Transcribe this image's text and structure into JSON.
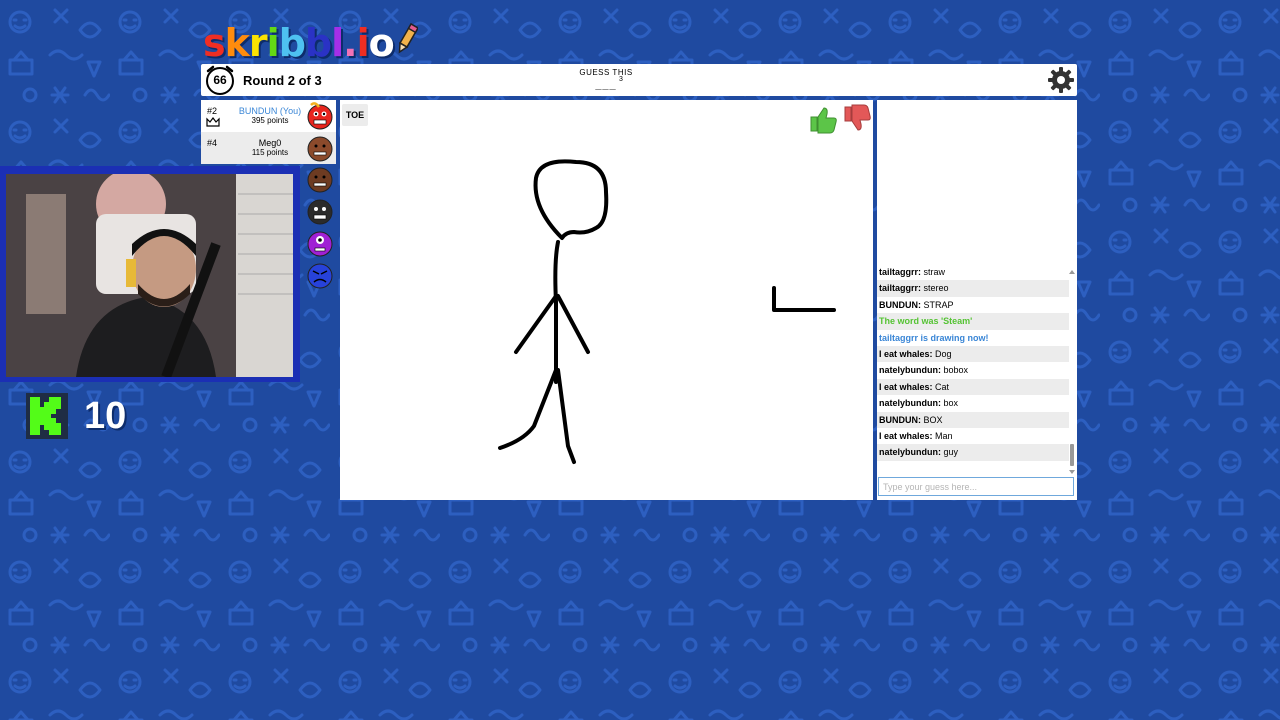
{
  "logo": {
    "text": "skribbl.io",
    "letter_colors": [
      "#ef2e23",
      "#ff8c0d",
      "#fce301",
      "#64d915",
      "#4ec1f1",
      "#2a32c5",
      "#a52fe8",
      "#f272b7",
      "#ef2e23",
      "#ffffff"
    ]
  },
  "header": {
    "timer": "66",
    "round_text": "Round 2 of 3",
    "guess_label": "GUESS THIS",
    "word_blanks": "___",
    "word_length": "3",
    "settings_icon": "gear-icon"
  },
  "players": [
    {
      "rank": "#2",
      "name": "BUNDUN (You)",
      "points": "395 points",
      "is_you": true,
      "crown": true,
      "avatar_color": "#e8261e"
    },
    {
      "rank": "#4",
      "name": "Meg0",
      "points": "115 points",
      "is_you": false,
      "crown": false,
      "avatar_color": "#8b4a2b"
    }
  ],
  "extra_avatars": [
    "#6d3b22",
    "#2b2b2b",
    "#a020d4",
    "#2742d9"
  ],
  "canvas": {
    "hint_text": "TOE",
    "like_icon": "thumbs-up-icon",
    "dislike_icon": "thumbs-down-icon",
    "like_color": "#5cc548",
    "dislike_color": "#e35858"
  },
  "chat": {
    "messages": [
      {
        "user": "tailtaggrr",
        "text": "straw",
        "type": "normal"
      },
      {
        "user": "tailtaggrr",
        "text": "stereo",
        "type": "normal"
      },
      {
        "user": "BUNDUN",
        "text": "STRAP",
        "type": "normal"
      },
      {
        "user": "",
        "text": "The word was 'Steam'",
        "type": "green"
      },
      {
        "user": "",
        "text": "tailtaggrr is drawing now!",
        "type": "blue"
      },
      {
        "user": "I eat whales",
        "text": "Dog",
        "type": "normal"
      },
      {
        "user": "natelybundun",
        "text": "bobox",
        "type": "normal"
      },
      {
        "user": "I eat whales",
        "text": "Cat",
        "type": "normal"
      },
      {
        "user": "natelybundun",
        "text": "box",
        "type": "normal"
      },
      {
        "user": "BUNDUN",
        "text": "BOX",
        "type": "normal"
      },
      {
        "user": "I eat whales",
        "text": "Man",
        "type": "normal"
      },
      {
        "user": "natelybundun",
        "text": "guy",
        "type": "normal"
      }
    ],
    "input_placeholder": "Type your guess here..."
  },
  "kick": {
    "icon": "kick-logo-icon",
    "viewer_count": "10",
    "color": "#53fc18"
  }
}
